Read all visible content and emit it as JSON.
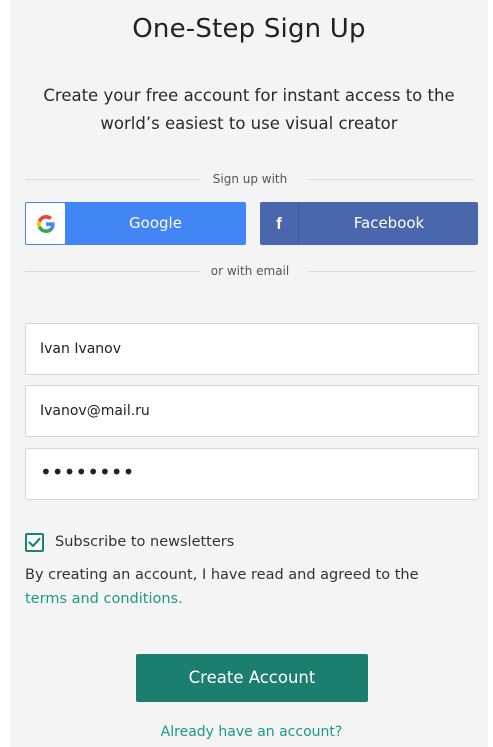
{
  "form": {
    "title": "One-Step Sign Up",
    "subtitle": "Create your free account for instant access to the world’s easiest to use visual creator",
    "social_divider": "Sign up with",
    "google_label": "Google",
    "facebook_label": "Facebook",
    "facebook_icon_glyph": "f",
    "email_divider": "or with email",
    "name_value": "Ivan Ivanov",
    "email_value": "Ivanov@mail.ru",
    "password_value": "••••••••",
    "subscribe_label": "Subscribe to newsletters",
    "subscribe_checked": true,
    "agree_text": "By creating an account, I have read and agreed to the",
    "terms_link": "terms and conditions.",
    "create_button": "Create Account",
    "signin_link": "Already have an account?"
  },
  "icons": {
    "google": "google-icon",
    "facebook": "facebook-icon",
    "check": "checkmark-icon"
  },
  "colors": {
    "google_blue": "#4285f4",
    "facebook_blue": "#4a67ad",
    "accent_teal": "#1a7f6e",
    "link_teal": "#1a9a86"
  }
}
